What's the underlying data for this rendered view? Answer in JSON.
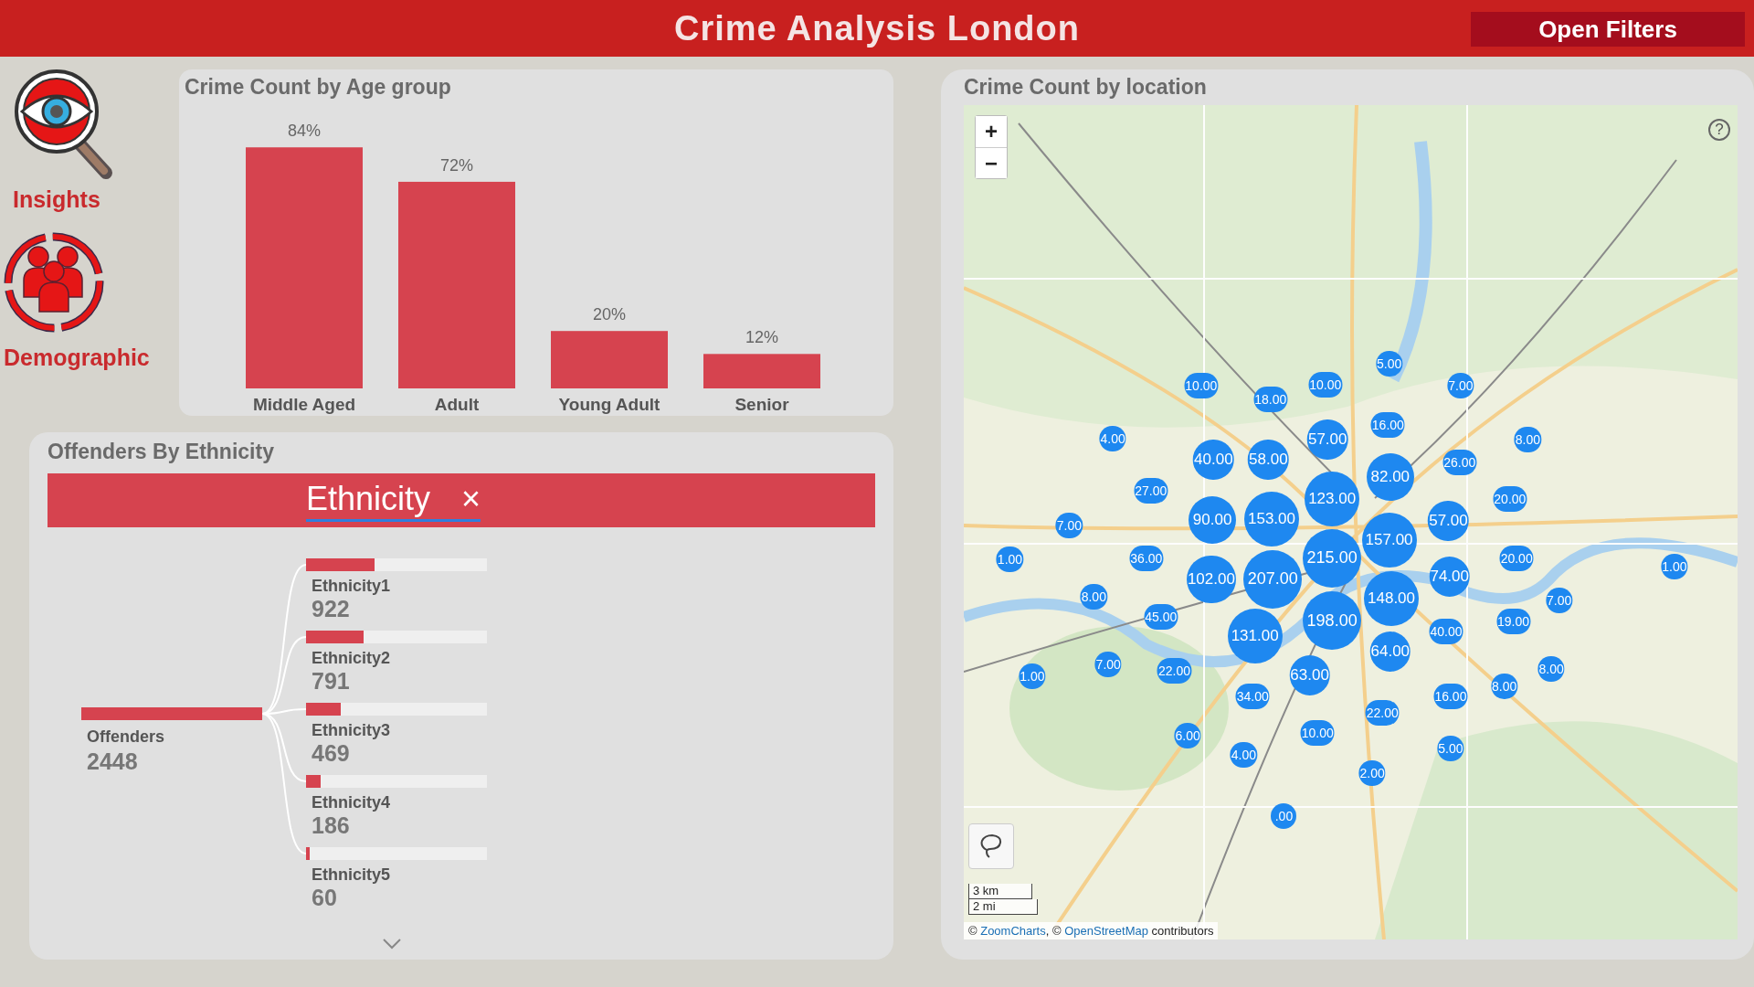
{
  "header": {
    "title": "Crime Analysis London",
    "filter_button": "Open Filters"
  },
  "sidebar": {
    "items": [
      {
        "label": "Insights",
        "kind": "insights"
      },
      {
        "label": "Demographic",
        "kind": "demographic"
      }
    ]
  },
  "age_panel": {
    "title": "Crime Count by Age group",
    "chart_data": {
      "type": "bar",
      "categories": [
        "Middle Aged",
        "Adult",
        "Young Adult",
        "Senior"
      ],
      "values": [
        84,
        72,
        20,
        12
      ],
      "value_labels": [
        "84%",
        "72%",
        "20%",
        "12%"
      ],
      "data_labels": true
    }
  },
  "ethnicity_panel": {
    "title": "Offenders By Ethnicity",
    "filter": {
      "label": "Ethnicity",
      "close": "×"
    },
    "root": {
      "label": "Offenders",
      "value": "2448"
    },
    "children": [
      {
        "label": "Ethnicity1",
        "value": "922",
        "level": 0.38
      },
      {
        "label": "Ethnicity2",
        "value": "791",
        "level": 0.32
      },
      {
        "label": "Ethnicity3",
        "value": "469",
        "level": 0.19
      },
      {
        "label": "Ethnicity4",
        "value": "186",
        "level": 0.08
      },
      {
        "label": "Ethnicity5",
        "value": "60",
        "level": 0.02
      }
    ]
  },
  "map_panel": {
    "title": "Crime Count by location",
    "zoom_in": "+",
    "zoom_out": "−",
    "help": "?",
    "scale": [
      "3 km",
      "2 mi"
    ],
    "attribution": {
      "prefix": "©",
      "link_1": "ZoomCharts",
      "middle": ", ©",
      "link_2": "OpenStreetMap",
      "suffix": "contributors"
    },
    "bubbles": [
      {
        "label": "5.00",
        "kind": "tiny"
      },
      {
        "label": "10.00",
        "kind": "tiny"
      },
      {
        "label": "10.00",
        "kind": "tiny"
      },
      {
        "label": "7.00",
        "kind": "tiny"
      },
      {
        "label": "18.00",
        "kind": "tiny"
      },
      {
        "label": "16.00",
        "kind": "tiny"
      },
      {
        "label": "4.00",
        "kind": "tiny"
      },
      {
        "label": "57.00",
        "kind": "small"
      },
      {
        "label": "8.00",
        "kind": "tiny"
      },
      {
        "label": "40.00",
        "kind": "small"
      },
      {
        "label": "58.00",
        "kind": "small"
      },
      {
        "label": "26.00",
        "kind": "tiny"
      },
      {
        "label": "82.00",
        "kind": "medium"
      },
      {
        "label": "27.00",
        "kind": "tiny"
      },
      {
        "label": "123.00",
        "kind": "large"
      },
      {
        "label": "20.00",
        "kind": "tiny"
      },
      {
        "label": "7.00",
        "kind": "tiny"
      },
      {
        "label": "90.00",
        "kind": "medium"
      },
      {
        "label": "153.00",
        "kind": "large"
      },
      {
        "label": "57.00",
        "kind": "small"
      },
      {
        "label": "157.00",
        "kind": "large"
      },
      {
        "label": "1.00",
        "kind": "tiny"
      },
      {
        "label": "36.00",
        "kind": "tiny"
      },
      {
        "label": "215.00",
        "kind": "huge"
      },
      {
        "label": "20.00",
        "kind": "tiny"
      },
      {
        "label": "1.00",
        "kind": "tiny"
      },
      {
        "label": "102.00",
        "kind": "medium"
      },
      {
        "label": "207.00",
        "kind": "huge"
      },
      {
        "label": "74.00",
        "kind": "small"
      },
      {
        "label": "8.00",
        "kind": "tiny"
      },
      {
        "label": "148.00",
        "kind": "large"
      },
      {
        "label": "7.00",
        "kind": "tiny"
      },
      {
        "label": "45.00",
        "kind": "tiny"
      },
      {
        "label": "198.00",
        "kind": "huge"
      },
      {
        "label": "19.00",
        "kind": "tiny"
      },
      {
        "label": "131.00",
        "kind": "large"
      },
      {
        "label": "40.00",
        "kind": "tiny"
      },
      {
        "label": "64.00",
        "kind": "small"
      },
      {
        "label": "1.00",
        "kind": "tiny"
      },
      {
        "label": "7.00",
        "kind": "tiny"
      },
      {
        "label": "22.00",
        "kind": "tiny"
      },
      {
        "label": "63.00",
        "kind": "small"
      },
      {
        "label": "8.00",
        "kind": "tiny"
      },
      {
        "label": "8.00",
        "kind": "tiny"
      },
      {
        "label": "34.00",
        "kind": "tiny"
      },
      {
        "label": "16.00",
        "kind": "tiny"
      },
      {
        "label": "22.00",
        "kind": "tiny"
      },
      {
        "label": "6.00",
        "kind": "tiny"
      },
      {
        "label": "10.00",
        "kind": "tiny"
      },
      {
        "label": "5.00",
        "kind": "tiny"
      },
      {
        "label": "4.00",
        "kind": "tiny"
      },
      {
        "label": "2.00",
        "kind": "tiny"
      },
      {
        "label": ".00",
        "kind": "tiny"
      }
    ]
  }
}
